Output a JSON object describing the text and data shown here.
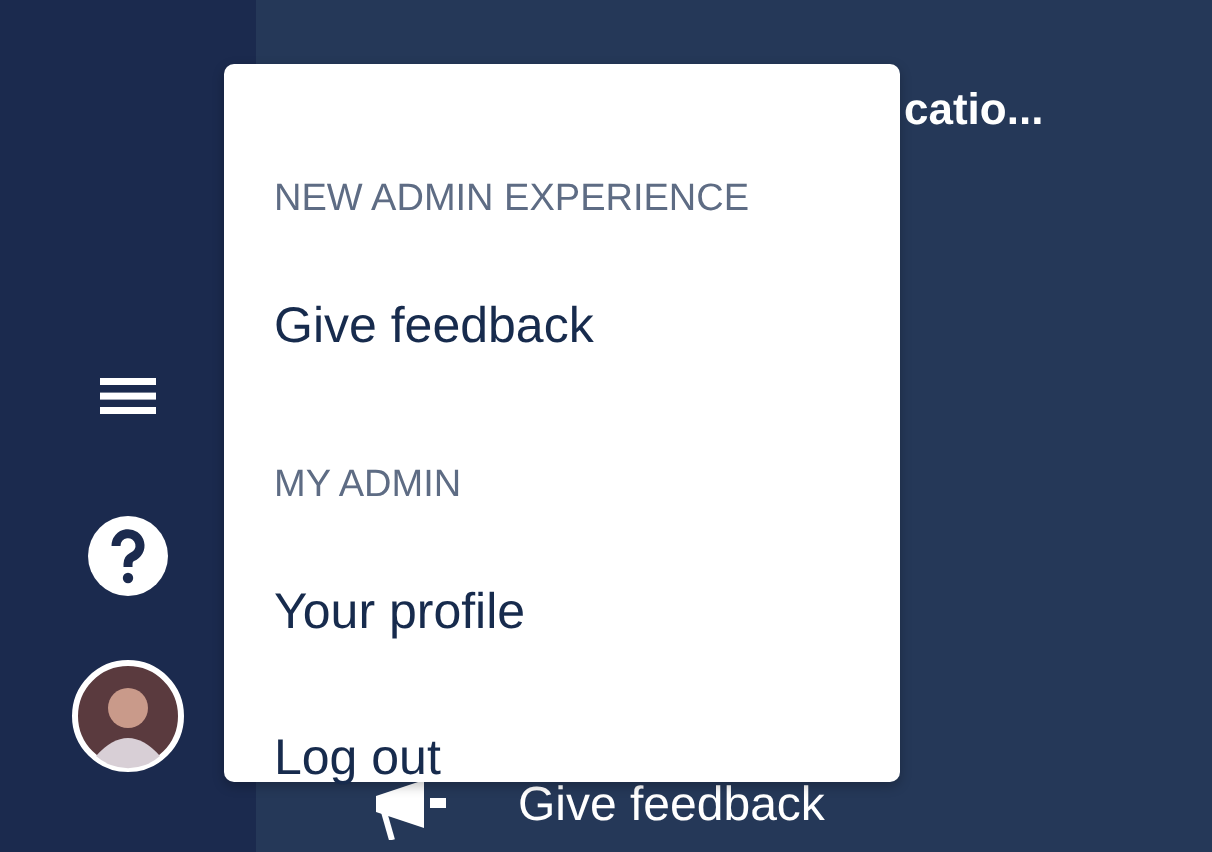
{
  "main": {
    "title": "catio...",
    "footer_link": "Give feedback"
  },
  "menu": {
    "sections": [
      {
        "heading": "NEW ADMIN EXPERIENCE",
        "items": [
          "Give feedback"
        ]
      },
      {
        "heading": "MY ADMIN",
        "items": [
          "Your profile",
          "Log out"
        ]
      }
    ]
  }
}
